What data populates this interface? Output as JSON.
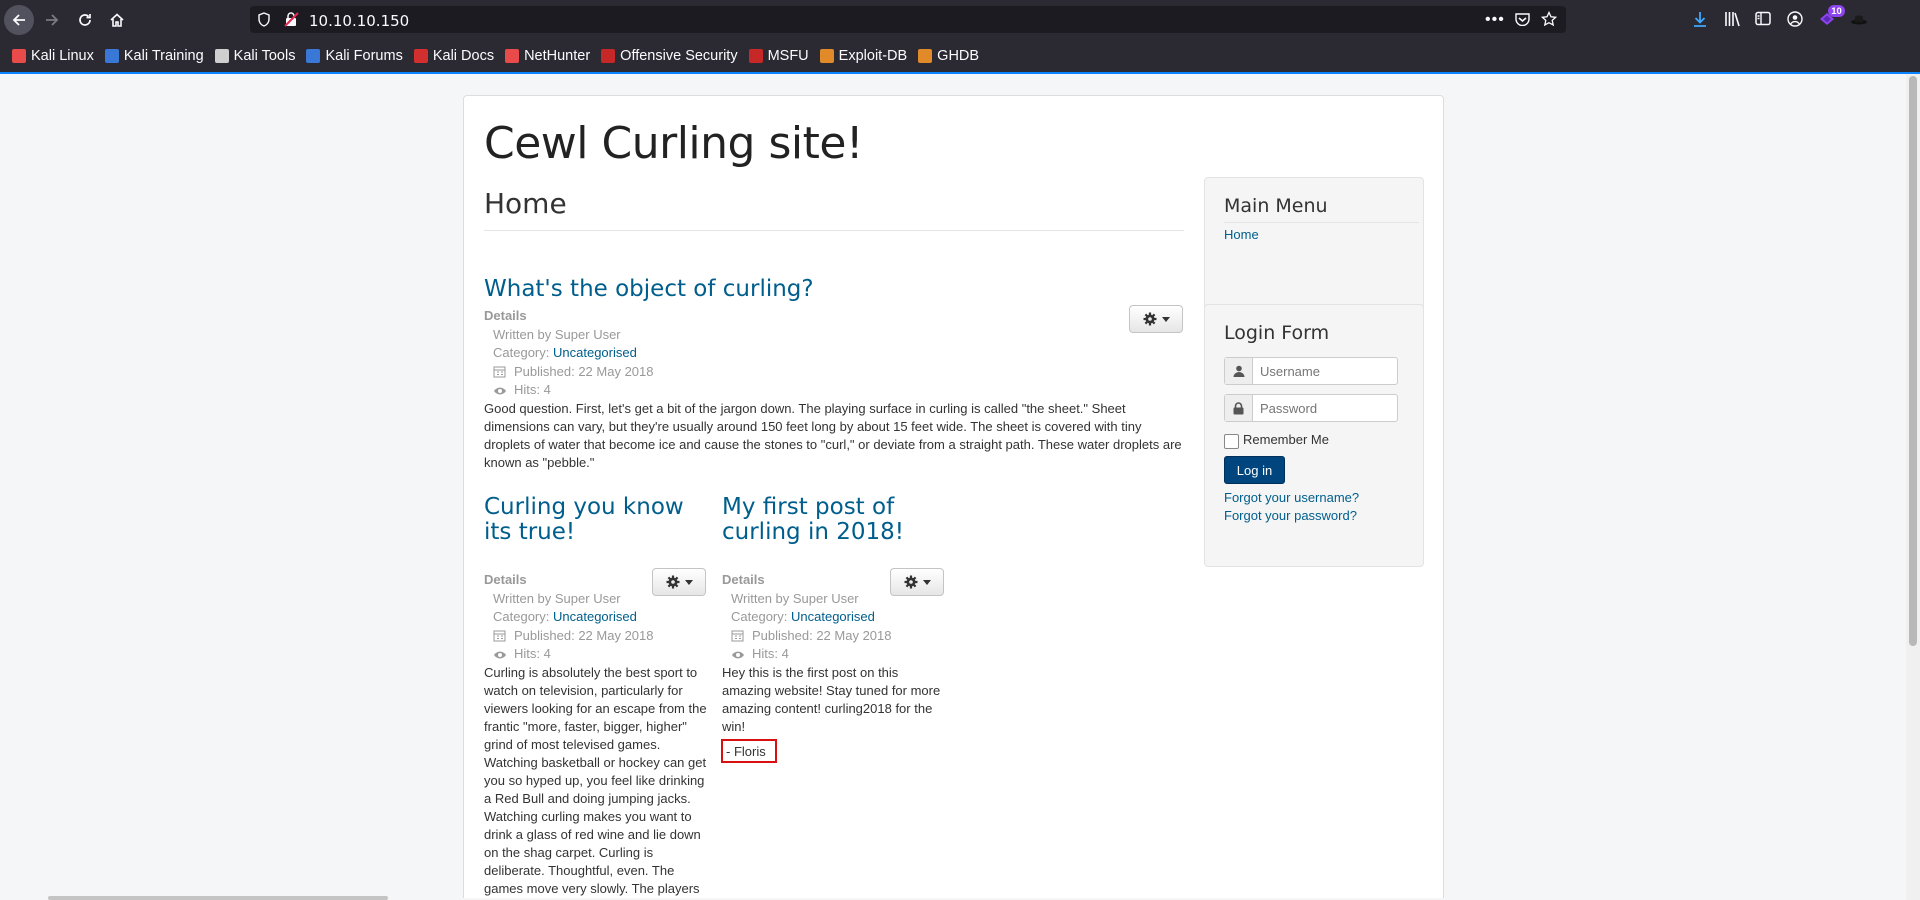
{
  "browser": {
    "url": "10.10.10.150",
    "downloads_badge": "10",
    "bookmarks": [
      {
        "label": "Kali Linux",
        "color": "#e94b4b"
      },
      {
        "label": "Kali Training",
        "color": "#3a78d8"
      },
      {
        "label": "Kali Tools",
        "color": "#cfcfcf"
      },
      {
        "label": "Kali Forums",
        "color": "#3a78d8"
      },
      {
        "label": "Kali Docs",
        "color": "#d32f2f"
      },
      {
        "label": "NetHunter",
        "color": "#e94b4b"
      },
      {
        "label": "Offensive Security",
        "color": "#c62828"
      },
      {
        "label": "MSFU",
        "color": "#c62828"
      },
      {
        "label": "Exploit-DB",
        "color": "#e08a2a"
      },
      {
        "label": "GHDB",
        "color": "#e08a2a"
      }
    ]
  },
  "site": {
    "title": "Cewl Curling site!",
    "page_heading": "Home"
  },
  "articles": [
    {
      "title": "What's the object of curling?",
      "details_label": "Details",
      "author": "Written by Super User",
      "category_label": "Category: ",
      "category": "Uncategorised",
      "published": "Published: 22 May 2018",
      "hits": "Hits: 4",
      "body": "Good question. First, let's get a bit of the jargon down. The playing surface in curling is called \"the sheet.\" Sheet dimensions can vary, but they're usually around 150 feet long by about 15 feet wide. The sheet is covered with tiny droplets of water that become ice and cause the stones to \"curl,\" or deviate from a straight path. These water droplets are known as \"pebble.\""
    },
    {
      "title": "Curling you know its true!",
      "details_label": "Details",
      "author": "Written by Super User",
      "category_label": "Category: ",
      "category": "Uncategorised",
      "published": "Published: 22 May 2018",
      "hits": "Hits: 4",
      "body": "Curling is absolutely the best sport to watch on television, particularly for viewers looking for an escape from the frantic \"more, faster, bigger, higher\" grind of most televised games. Watching basketball or hockey can get you so hyped up, you feel like drinking a Red Bull and doing jumping jacks. Watching curling makes you want to drink a glass of red wine and lie down on the shag carpet. Curling is deliberate. Thoughtful, even. The games move very slowly. The players"
    },
    {
      "title": "My first post of curling in 2018!",
      "details_label": "Details",
      "author": "Written by Super User",
      "category_label": "Category: ",
      "category": "Uncategorised",
      "published": "Published: 22 May 2018",
      "hits": "Hits: 4",
      "body": "Hey this is the first post on this amazing website! Stay tuned for more amazing content! curling2018 for the win!",
      "signature": "- Floris"
    }
  ],
  "sidebar": {
    "menu_title": "Main Menu",
    "menu_items": [
      "Home"
    ],
    "login_title": "Login Form",
    "username_placeholder": "Username",
    "password_placeholder": "Password",
    "remember_label": "Remember Me",
    "login_button": "Log in",
    "forgot_username": "Forgot your username?",
    "forgot_password": "Forgot your password?"
  }
}
